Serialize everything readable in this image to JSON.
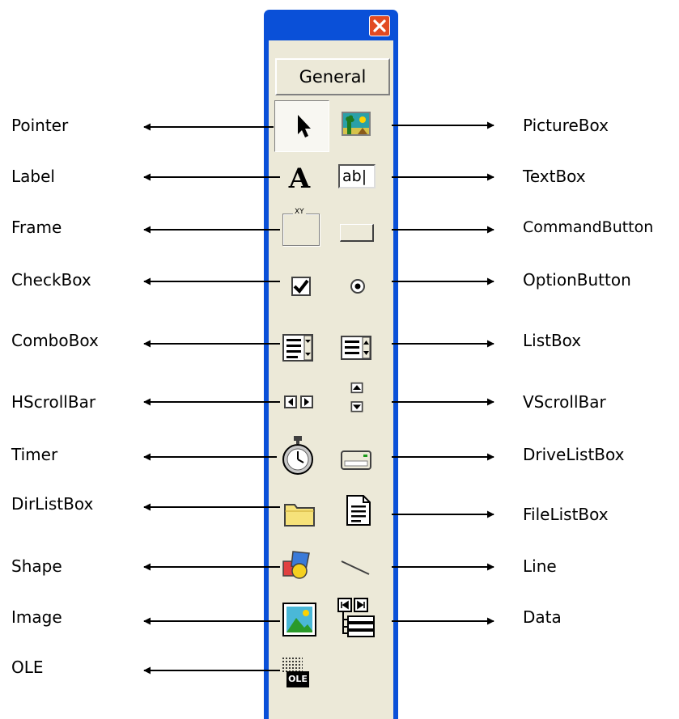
{
  "toolbox": {
    "tab_label": "General",
    "close_icon": "close-icon",
    "left_controls": [
      "Pointer",
      "Label",
      "Frame",
      "CheckBox",
      "ComboBox",
      "HScrollBar",
      "Timer",
      "DirListBox",
      "Shape",
      "Image",
      "OLE"
    ],
    "right_controls": [
      "PictureBox",
      "TextBox",
      "CommandButton",
      "OptionButton",
      "ListBox",
      "VScrollBar",
      "DriveListBox",
      "FileListBox",
      "Line",
      "Data"
    ],
    "frame_caption": "XY",
    "textbox_text": "ab|",
    "ole_text": "OLE"
  },
  "colors": {
    "title_blue": "#0a50d8",
    "face": "#ece9d8",
    "close_red": "#e24a22"
  }
}
